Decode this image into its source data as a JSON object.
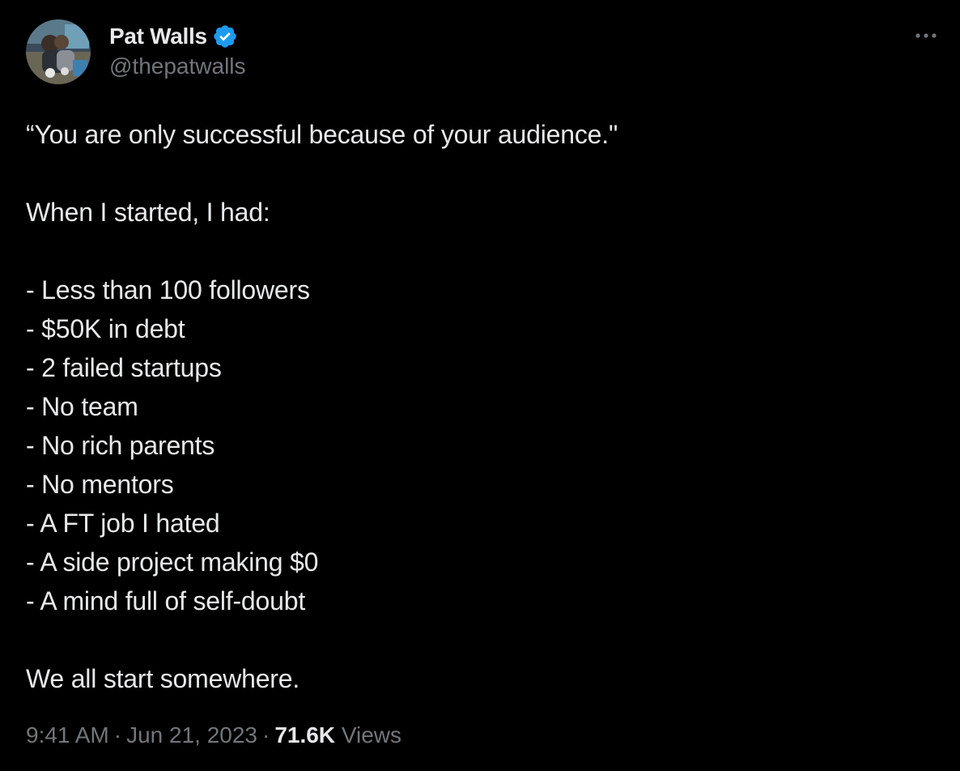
{
  "author": {
    "display_name": "Pat Walls",
    "handle": "@thepatwalls",
    "verified": true,
    "avatar_icon": "avatar-photo"
  },
  "tweet": {
    "quote": "“You are only successful because of your audience.\"",
    "intro": "When I started, I had:",
    "list": [
      "- Less than 100 followers",
      "- $50K in debt",
      "- 2 failed startups",
      "- No team",
      "- No rich parents",
      "- No mentors",
      "- A FT job I hated",
      "- A side project making $0",
      "- A mind full of self-doubt"
    ],
    "closing": "We all start somewhere."
  },
  "meta": {
    "time": "9:41 AM",
    "separator": "·",
    "date": "Jun 21, 2023",
    "views_count": "71.6K",
    "views_label": "Views"
  },
  "colors": {
    "background": "#000000",
    "text": "#e7e9ea",
    "secondary": "#71767b",
    "verified": "#1d9bf0"
  },
  "icons": {
    "verified": "verified-badge-icon",
    "more": "more-dots-icon"
  }
}
